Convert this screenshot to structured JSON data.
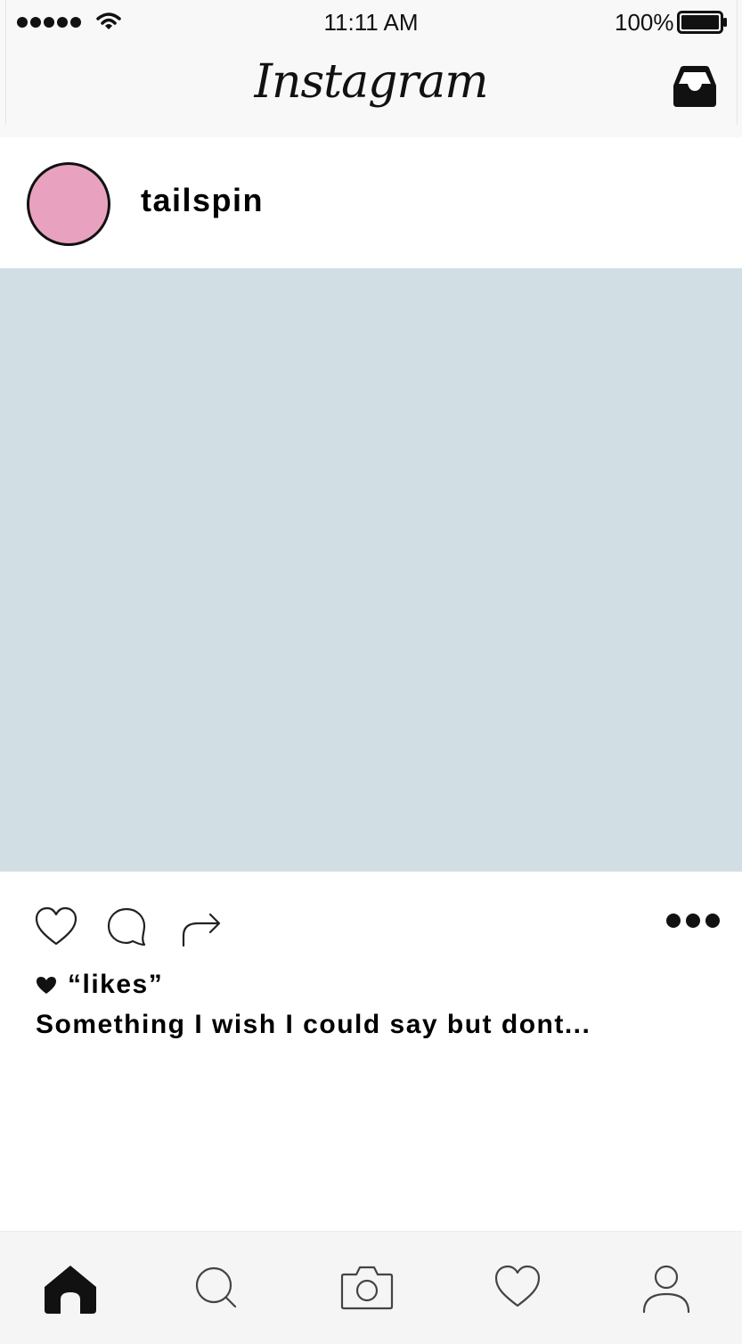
{
  "status_bar": {
    "time": "11:11 AM",
    "battery_percent": "100%",
    "signal_bars": 5,
    "icons": [
      "signal-dots-icon",
      "wifi-icon",
      "battery-icon"
    ]
  },
  "header": {
    "logo_text": "Instagram",
    "inbox_icon": "inbox-tray-icon"
  },
  "post": {
    "username": "tailspin",
    "avatar_color": "#e8a2c0",
    "image_color": "#d1dfe4",
    "actions": {
      "icons": [
        "heart-outline-icon",
        "comment-bubble-icon",
        "share-arrow-icon",
        "more-dots-icon"
      ]
    },
    "likes_text": "“likes”",
    "caption": "Something I wish I could say but dont..."
  },
  "tab_bar": {
    "active_tab": "home",
    "tabs": [
      "home-icon",
      "search-icon",
      "camera-icon",
      "heart-icon",
      "profile-icon"
    ]
  }
}
